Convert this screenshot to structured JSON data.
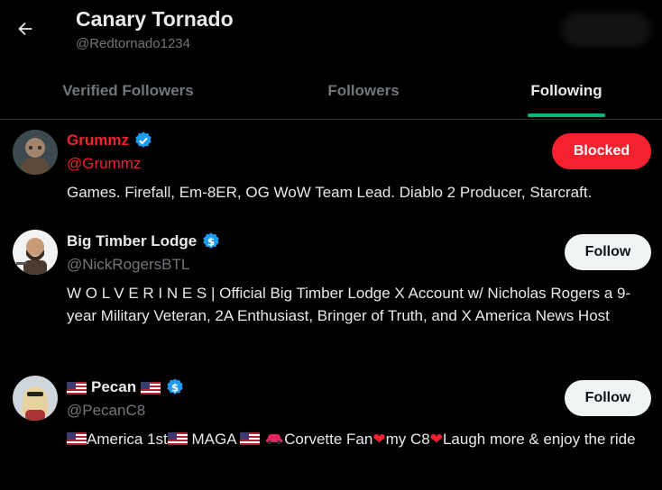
{
  "header": {
    "name": "Canary Tornado",
    "handle": "@Redtornado1234"
  },
  "tabs": [
    {
      "label": "Verified Followers",
      "active": false
    },
    {
      "label": "Followers",
      "active": false
    },
    {
      "label": "Following",
      "active": true
    }
  ],
  "users": [
    {
      "name": "Grummz",
      "handle": "@Grummz",
      "badge": "blue-verified-icon",
      "button": "Blocked",
      "bio": "Games. Firefall, Em-8ER, OG WoW Team Lead. Diablo 2 Producer, Starcraft."
    },
    {
      "name": "Big Timber Lodge",
      "handle": "@NickRogersBTL",
      "badge": "dollar-verified-icon",
      "button": "Follow",
      "bio": "W O L V E R I N E S | Official Big Timber Lodge X Account w/ Nicholas Rogers a 9-year Military Veteran, 2A Enthusiast, Bringer of Truth, and X America News Host"
    },
    {
      "name": "Pecan",
      "handle": "@PecanC8",
      "badge": "dollar-verified-icon",
      "button": "Follow",
      "bio_parts": {
        "p1": "America 1st",
        "p2": " MAGA ",
        "p3": "Corvette Fan",
        "p4": "my C8",
        "p5": "Laugh more & enjoy the ride"
      }
    }
  ],
  "colors": {
    "accent": "#1d9bf0",
    "tab_underline": "#00ba7c",
    "blocked": "#f4212e",
    "muted": "#71767b"
  }
}
